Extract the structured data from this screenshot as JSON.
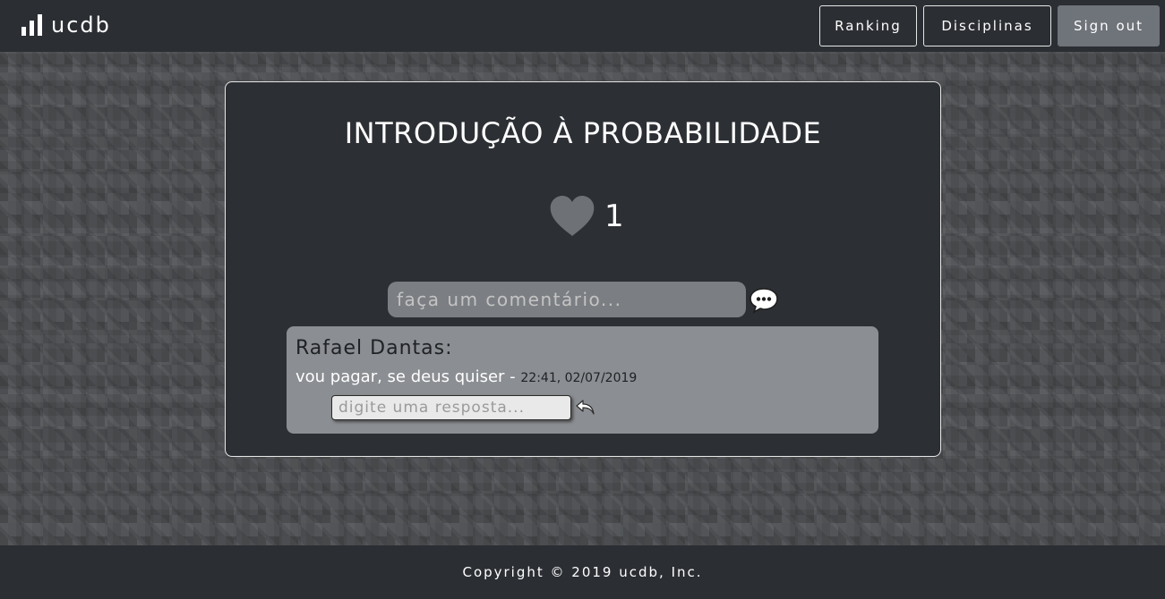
{
  "header": {
    "brand": "ucdb",
    "nav": {
      "ranking": "Ranking",
      "disciplinas": "Disciplinas",
      "signout": "Sign out"
    }
  },
  "subject": {
    "title": "INTRODUÇÃO À PROBABILIDADE",
    "likes": "1",
    "comment_placeholder": "faça um comentário..."
  },
  "comments": [
    {
      "author": "Rafael Dantas:",
      "text": "vou pagar, se deus quiser",
      "separator": " - ",
      "timestamp": "22:41, 02/07/2019",
      "reply_placeholder": "digite uma resposta..."
    }
  ],
  "footer": {
    "copyright": "Copyright © 2019 ucdb, Inc."
  },
  "icons": {
    "brand": "bar-chart-icon",
    "like": "heart-icon",
    "comment": "speech-bubble-icon",
    "reply": "reply-arrow-icon"
  },
  "colors": {
    "navbar": "#2b2e33",
    "card": "#2c2f34",
    "comment_box": "#8b8e92",
    "heart": "#6e7176",
    "signout_button": "#6f737a"
  }
}
